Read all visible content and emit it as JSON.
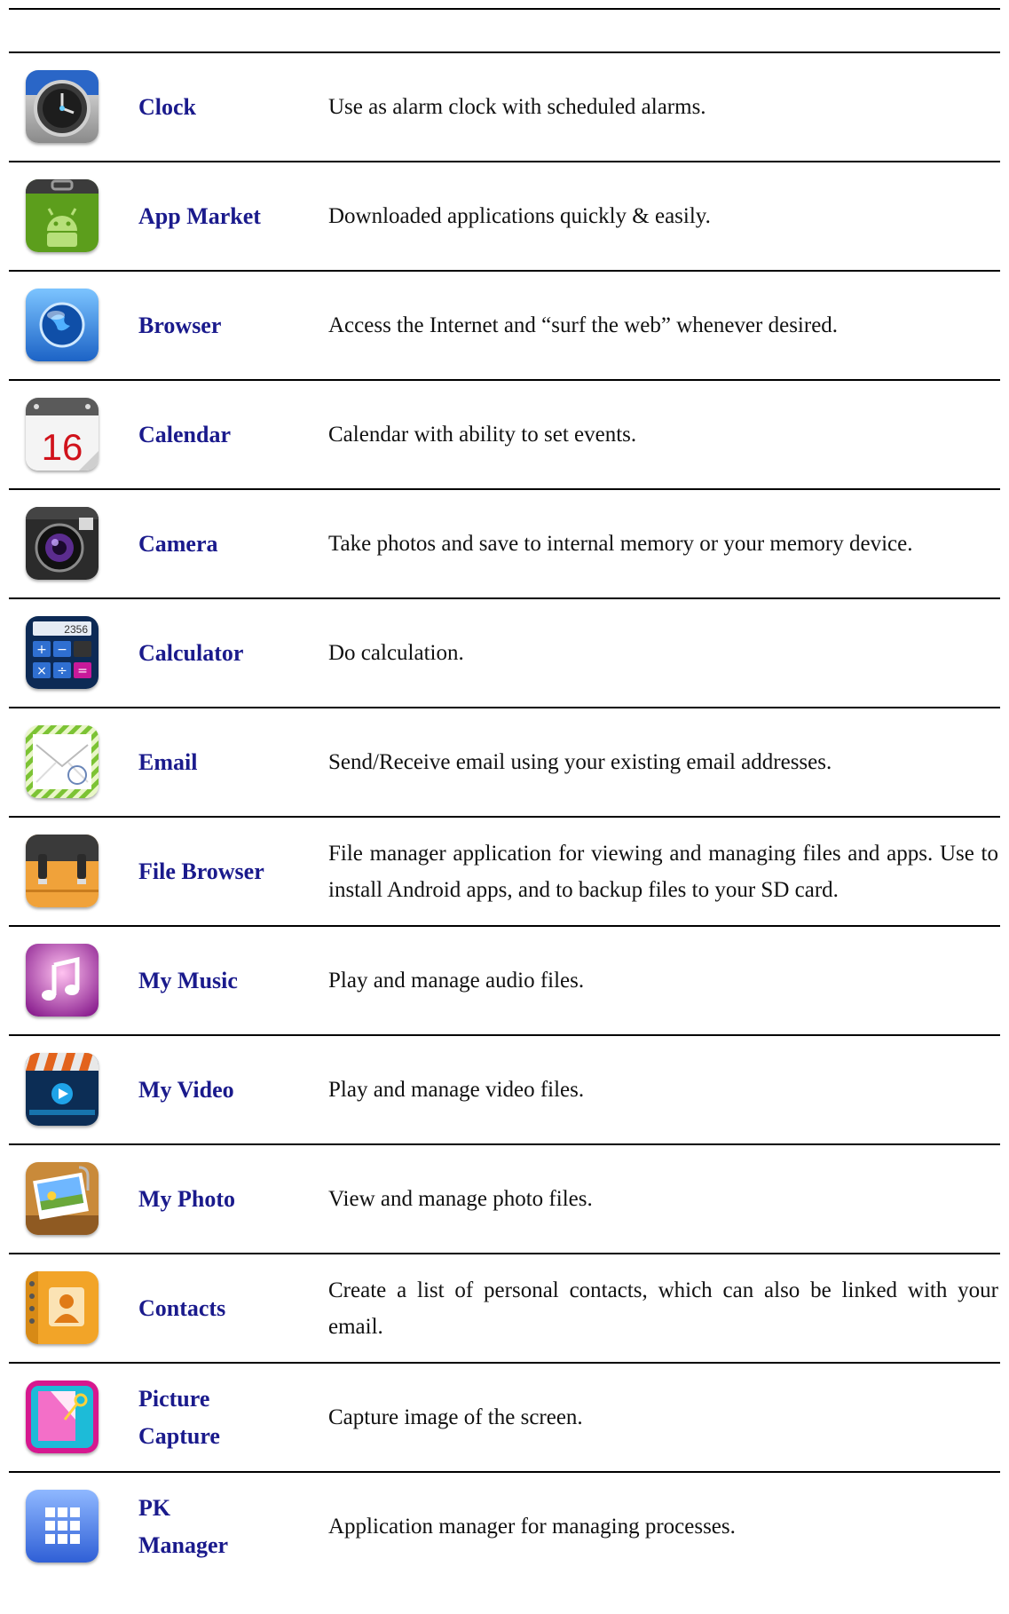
{
  "apps": [
    {
      "name": "Clock",
      "description": "Use as alarm clock with scheduled alarms.",
      "icon": "clock-icon"
    },
    {
      "name": "App Market",
      "description": "Downloaded applications quickly & easily.",
      "icon": "app-market-icon"
    },
    {
      "name": "Browser",
      "description": "Access the Internet and “surf the web” whenever desired.",
      "icon": "browser-globe-icon"
    },
    {
      "name": "Calendar",
      "description": "Calendar with ability to set events.",
      "icon": "calendar-icon",
      "icon_text": "16"
    },
    {
      "name": "Camera",
      "description": "Take photos and save to internal memory or your memory device.",
      "icon": "camera-icon"
    },
    {
      "name": "Calculator",
      "description": "Do calculation.",
      "icon": "calculator-icon",
      "icon_text": "2356"
    },
    {
      "name": "Email",
      "description": "Send/Receive email using your existing email addresses.",
      "icon": "email-envelope-icon"
    },
    {
      "name": "File Browser",
      "description": "File manager application for viewing and managing files and apps. Use to install Android apps, and to backup files to your SD card.",
      "icon": "file-browser-icon"
    },
    {
      "name": "My Music",
      "description": "Play and manage audio files.",
      "icon": "music-note-icon"
    },
    {
      "name": "My Video",
      "description": "Play and manage video files.",
      "icon": "video-clapper-icon"
    },
    {
      "name": "My Photo",
      "description": "View and manage photo files.",
      "icon": "photo-icon"
    },
    {
      "name": "Contacts",
      "description": "Create a list of personal contacts, which can also be linked with your email.",
      "icon": "contacts-book-icon"
    },
    {
      "name": "Picture Capture",
      "description": "Capture image of the screen.",
      "icon": "picture-capture-icon"
    },
    {
      "name": "PK Manager",
      "description": "Application manager for managing processes.",
      "icon": "pk-manager-grid-icon"
    }
  ],
  "colors": {
    "app_name": "#1a1a8c",
    "rule": "#000000"
  }
}
